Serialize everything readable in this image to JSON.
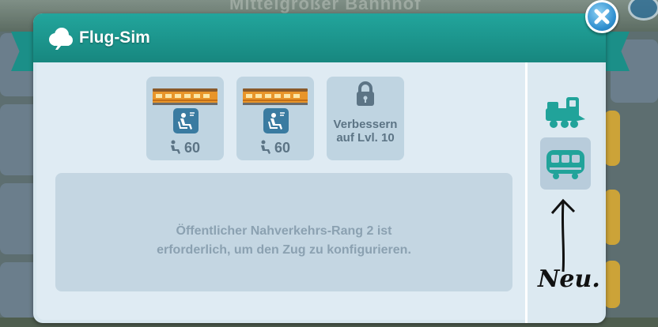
{
  "background": {
    "title": "Mittelgroßer Bahnhof"
  },
  "dialog": {
    "title": "Flug-Sim",
    "title_icon": "plane-cloud-icon",
    "close_icon": "close-icon"
  },
  "slots": [
    {
      "type": "wagon",
      "icon": "passenger-car-icon",
      "badge_icon": "seat-icon",
      "capacity": "60"
    },
    {
      "type": "wagon",
      "icon": "passenger-car-icon",
      "badge_icon": "seat-icon",
      "capacity": "60"
    },
    {
      "type": "locked",
      "icon": "lock-icon",
      "label": "Verbessern\nauf Lvl. 10"
    }
  ],
  "info_message": "Öffentlicher Nahverkehrs-Rang 2 ist\nerforderlich, um den Zug zu konfigurieren.",
  "sidebar": {
    "items": [
      {
        "icon": "locomotive-icon",
        "selected": false
      },
      {
        "icon": "wagon-icon",
        "selected": true
      }
    ]
  },
  "annotation": {
    "text": "Neu."
  },
  "colors": {
    "header_teal": "#1b8f88",
    "panel_bg": "#d7e6ee",
    "slot_bg": "#bfd4e1",
    "text_muted": "#5c7485",
    "info_text": "#8ba1b1",
    "accent_blue": "#3a7ba1",
    "train_orange": "#e8952a"
  }
}
